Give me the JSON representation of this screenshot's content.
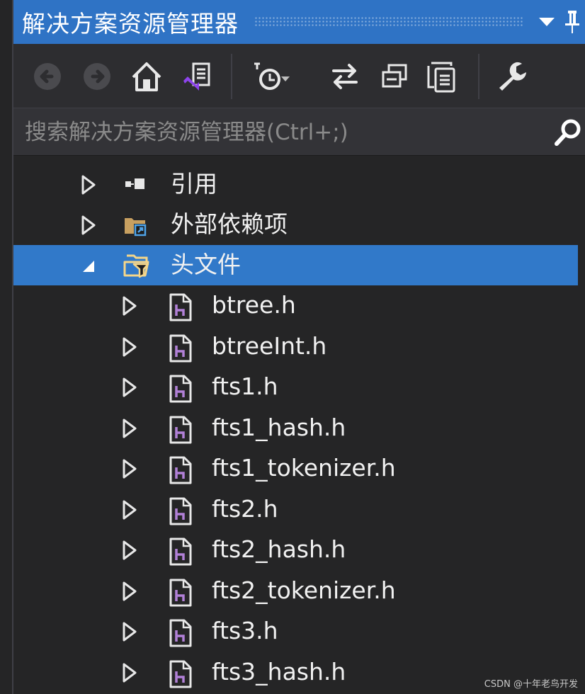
{
  "window": {
    "title": "解决方案资源管理器",
    "buttons": [
      "dropdown-icon",
      "pin-icon"
    ]
  },
  "toolbar": {
    "items": [
      "back-icon",
      "forward-icon",
      "home-icon",
      "switch-views-icon",
      "pending-changes-filter-icon",
      "sync-with-active-document-icon",
      "collapse-all-icon",
      "show-all-files-icon",
      "properties-icon"
    ]
  },
  "search": {
    "placeholder": "搜索解决方案资源管理器(Ctrl+;)"
  },
  "tree": {
    "nodes": [
      {
        "label": "引用",
        "icon": "references-icon",
        "expanded": false,
        "selected": false
      },
      {
        "label": "外部依赖项",
        "icon": "external-dependencies-icon",
        "expanded": false,
        "selected": false
      },
      {
        "label": "头文件",
        "icon": "filter-folder-icon",
        "expanded": true,
        "selected": true
      },
      {
        "label": "btree.h",
        "icon": "header-file-icon",
        "expanded": false
      },
      {
        "label": "btreeInt.h",
        "icon": "header-file-icon",
        "expanded": false
      },
      {
        "label": "fts1.h",
        "icon": "header-file-icon",
        "expanded": false
      },
      {
        "label": "fts1_hash.h",
        "icon": "header-file-icon",
        "expanded": false
      },
      {
        "label": "fts1_tokenizer.h",
        "icon": "header-file-icon",
        "expanded": false
      },
      {
        "label": "fts2.h",
        "icon": "header-file-icon",
        "expanded": false
      },
      {
        "label": "fts2_hash.h",
        "icon": "header-file-icon",
        "expanded": false
      },
      {
        "label": "fts2_tokenizer.h",
        "icon": "header-file-icon",
        "expanded": false
      },
      {
        "label": "fts3.h",
        "icon": "header-file-icon",
        "expanded": false
      },
      {
        "label": "fts3_hash.h",
        "icon": "header-file-icon",
        "expanded": false
      }
    ]
  },
  "colors": {
    "title_bar": "#2f73c5",
    "selection": "#3179c9",
    "background": "#252526",
    "header_icon_accent": "#b180d7"
  },
  "watermark": "CSDN @十年老鸟开发"
}
